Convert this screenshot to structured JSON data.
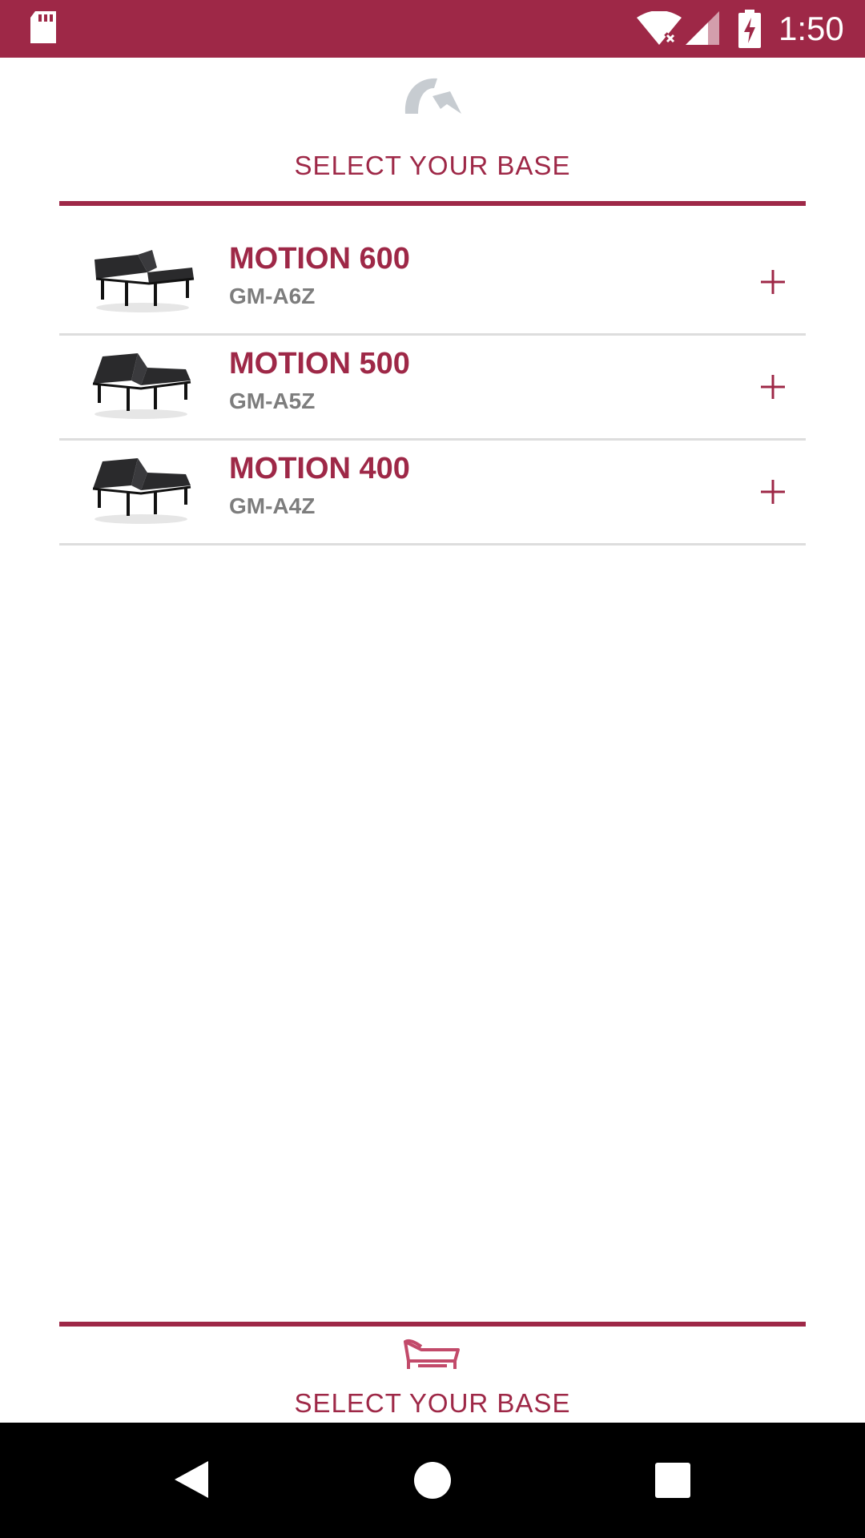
{
  "status_bar": {
    "time": "1:50",
    "icons": [
      "sd-card-icon",
      "wifi-icon",
      "signal-icon",
      "battery-charging-icon"
    ],
    "color": "#9e2847"
  },
  "header": {
    "logo_icon": "logo-icon",
    "title": "SELECT YOUR BASE"
  },
  "products": [
    {
      "name": "MOTION 600",
      "sku": "GM-A6Z",
      "action_icon": "plus-icon"
    },
    {
      "name": "MOTION 500",
      "sku": "GM-A5Z",
      "action_icon": "plus-icon"
    },
    {
      "name": "MOTION 400",
      "sku": "GM-A4Z",
      "action_icon": "plus-icon"
    }
  ],
  "bottom_tab": {
    "icon": "adjustable-base-icon",
    "label": "SELECT YOUR BASE"
  },
  "nav_bar": {
    "icons": [
      "back-icon",
      "home-icon",
      "recents-icon"
    ]
  },
  "colors": {
    "accent": "#9e2847",
    "muted_text": "#7d7d7d",
    "divider": "#dddddd"
  }
}
